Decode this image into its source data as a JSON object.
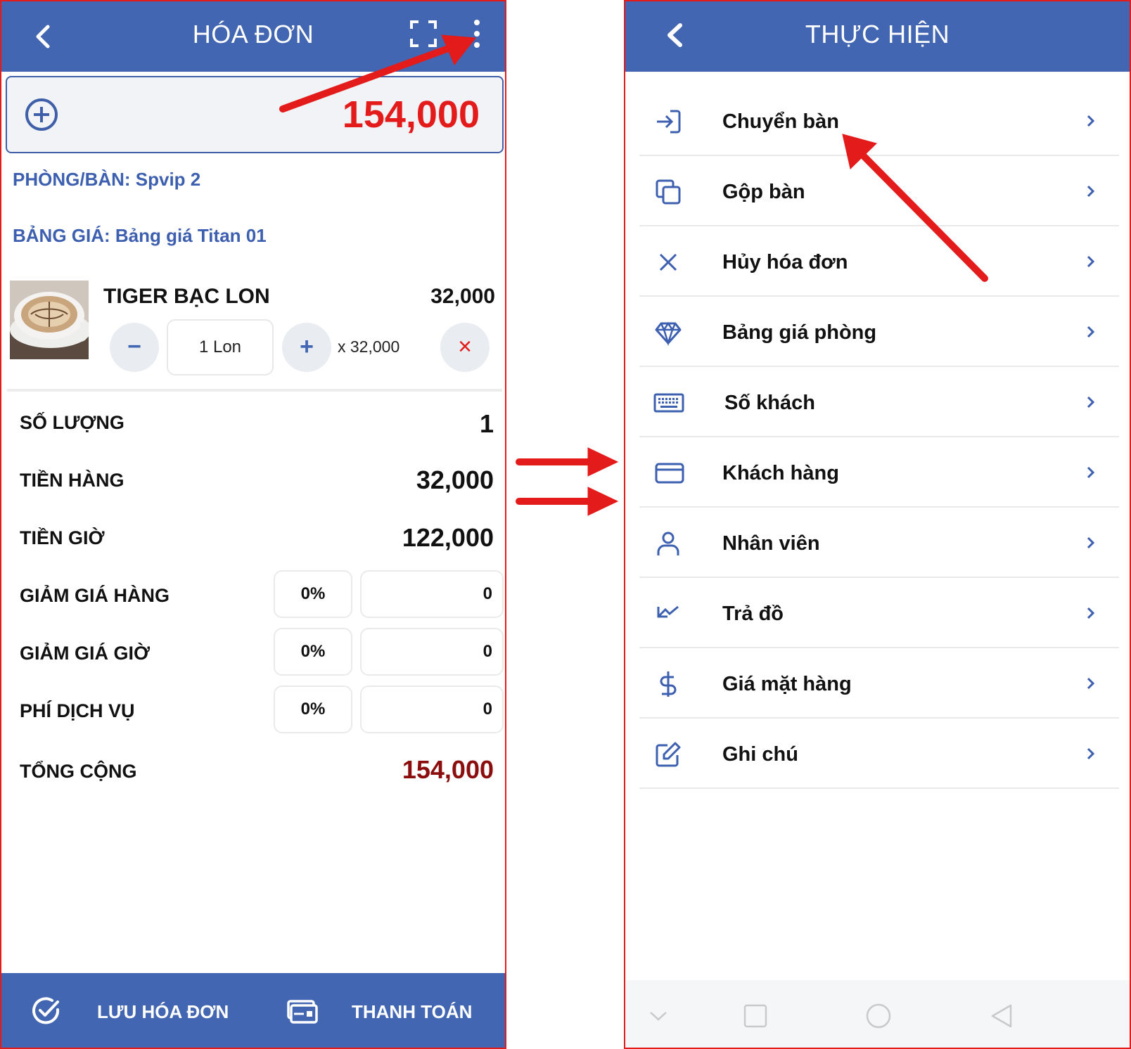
{
  "left": {
    "title": "HÓA ĐƠN",
    "total": "154,000",
    "room_line": "PHÒNG/BÀN: Spvip 2",
    "price_table_line": "BẢNG GIÁ: Bảng giá Titan 01",
    "item": {
      "name": "TIGER BẠC LON",
      "price": "32,000",
      "minus": "−",
      "qty": "1 Lon",
      "plus": "+",
      "multiplier": "x 32,000",
      "remove": "×"
    },
    "summary": {
      "qty_label": "SỐ LƯỢNG",
      "qty_value": "1",
      "goods_label": "TIỀN HÀNG",
      "goods_value": "32,000",
      "hours_label": "TIỀN GIỜ",
      "hours_value": "122,000",
      "disc_goods_label": "GIẢM GIÁ HÀNG",
      "disc_goods_pct": "0%",
      "disc_goods_amt": "0",
      "disc_hours_label": "GIẢM GIÁ GIỜ",
      "disc_hours_pct": "0%",
      "disc_hours_amt": "0",
      "service_label": "PHÍ DỊCH VỤ",
      "service_pct": "0%",
      "service_amt": "0",
      "total_label": "TỔNG CỘNG",
      "total_value": "154,000"
    },
    "bottom": {
      "save_label": "LƯU HÓA ĐƠN",
      "pay_label": "THANH TOÁN"
    }
  },
  "right": {
    "title": "THỰC HIỆN",
    "menu": [
      {
        "label": "Chuyển bàn",
        "icon": "move-in-icon"
      },
      {
        "label": "Gộp bàn",
        "icon": "copy-icon"
      },
      {
        "label": "Hủy hóa đơn",
        "icon": "close-icon"
      },
      {
        "label": "Bảng giá phòng",
        "icon": "diamond-icon"
      },
      {
        "label": "Số khách",
        "icon": "keyboard-icon"
      },
      {
        "label": "Khách hàng",
        "icon": "card-icon"
      },
      {
        "label": "Nhân viên",
        "icon": "user-icon"
      },
      {
        "label": "Trả đồ",
        "icon": "return-arrow-icon"
      },
      {
        "label": "Giá mặt hàng",
        "icon": "dollar-icon"
      },
      {
        "label": "Ghi chú",
        "icon": "edit-icon"
      }
    ]
  },
  "colors": {
    "header_blue": "#4266b2",
    "accent_red": "#e31b1b",
    "total_dark_red": "#8b0d0d",
    "info_blue": "#3d5fb0"
  }
}
